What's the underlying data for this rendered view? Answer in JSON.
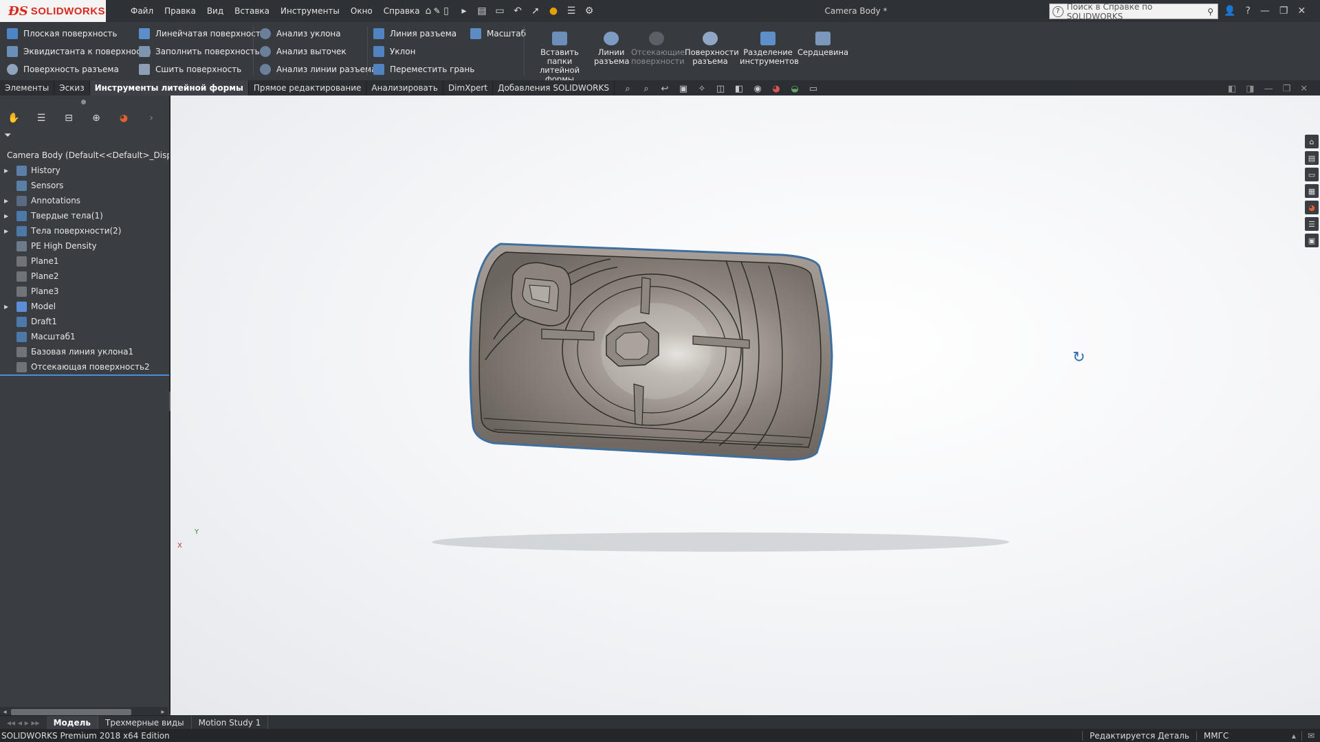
{
  "app": {
    "brand": "SOLIDWORKS",
    "document_title": "Camera Body *",
    "search_placeholder": "Поиск в Справке по SOLIDWORKS"
  },
  "menu": [
    "Файл",
    "Правка",
    "Вид",
    "Вставка",
    "Инструменты",
    "Окно",
    "Справка"
  ],
  "commands": {
    "col1": [
      "Плоская поверхность",
      "Эквидистанта к поверхности",
      "Поверхность разъема"
    ],
    "col2": [
      "Линейчатая поверхность",
      "Заполнить поверхность",
      "Сшить поверхность"
    ],
    "col3": [
      "Анализ уклона",
      "Анализ выточек",
      "Анализ линии разъема"
    ],
    "col4": [
      "Линия разъема",
      "Уклон",
      "Переместить грань"
    ],
    "col5": [
      "Масштаб"
    ],
    "big": [
      {
        "label": "Вставить папки литейной формы",
        "enabled": true
      },
      {
        "label": "Линии разъема",
        "enabled": true
      },
      {
        "label": "Отсекающие поверхности",
        "enabled": false
      },
      {
        "label": "Поверхности разъема",
        "enabled": true
      },
      {
        "label": "Разделение инструментов",
        "enabled": true
      },
      {
        "label": "Сердцевина",
        "enabled": true
      }
    ]
  },
  "tabs": [
    {
      "label": "Элементы",
      "active": false
    },
    {
      "label": "Эскиз",
      "active": false
    },
    {
      "label": "Инструменты литейной формы",
      "active": true
    },
    {
      "label": "Прямое редактирование",
      "active": false
    },
    {
      "label": "Анализировать",
      "active": false
    },
    {
      "label": "DimXpert",
      "active": false
    },
    {
      "label": "Добавления SOLIDWORKS",
      "active": false
    }
  ],
  "tree": {
    "root": "Camera Body  (Default<<Default>_Displa",
    "items": [
      {
        "label": "History",
        "expandable": true,
        "icon": "history-icon",
        "color": "#5a7fa8"
      },
      {
        "label": "Sensors",
        "expandable": false,
        "icon": "sensor-icon",
        "color": "#5a7fa8"
      },
      {
        "label": "Annotations",
        "expandable": true,
        "icon": "annotation-icon",
        "color": "#5a6a80"
      },
      {
        "label": "Твердые тела(1)",
        "expandable": true,
        "icon": "solid-bodies-icon",
        "color": "#4d79a8"
      },
      {
        "label": "Тела поверхности(2)",
        "expandable": true,
        "icon": "surface-bodies-icon",
        "color": "#4d79a8"
      },
      {
        "label": "PE High Density",
        "expandable": false,
        "icon": "material-icon",
        "color": "#6c7a8c"
      },
      {
        "label": "Plane1",
        "expandable": false,
        "icon": "plane-icon",
        "color": "#707378"
      },
      {
        "label": "Plane2",
        "expandable": false,
        "icon": "plane-icon",
        "color": "#707378"
      },
      {
        "label": "Plane3",
        "expandable": false,
        "icon": "plane-icon",
        "color": "#707378"
      },
      {
        "label": "Model",
        "expandable": true,
        "icon": "folder-icon",
        "color": "#5b8ed6"
      },
      {
        "label": "Draft1",
        "expandable": false,
        "icon": "draft-icon",
        "color": "#4d79a8"
      },
      {
        "label": "Масштаб1",
        "expandable": false,
        "icon": "scale-icon",
        "color": "#4d79a8"
      },
      {
        "label": "Базовая линия уклона1",
        "expandable": false,
        "icon": "draft-line-icon",
        "color": "#707378"
      },
      {
        "label": "Отсекающая поверхность2",
        "expandable": false,
        "icon": "shutoff-surface-icon",
        "color": "#707378"
      }
    ]
  },
  "bottom_tabs": [
    {
      "label": "Модель",
      "active": true
    },
    {
      "label": "Трехмерные виды",
      "active": false
    },
    {
      "label": "Motion Study 1",
      "active": false
    }
  ],
  "status": {
    "edition": "SOLIDWORKS Premium 2018 x64 Edition",
    "mode": "Редактируется Деталь",
    "units": "ММГС"
  },
  "triad": {
    "x": "X",
    "y": "Y"
  },
  "colors": {
    "accent": "#4a90d9",
    "brand": "#da291c",
    "part": "#8d857d"
  }
}
